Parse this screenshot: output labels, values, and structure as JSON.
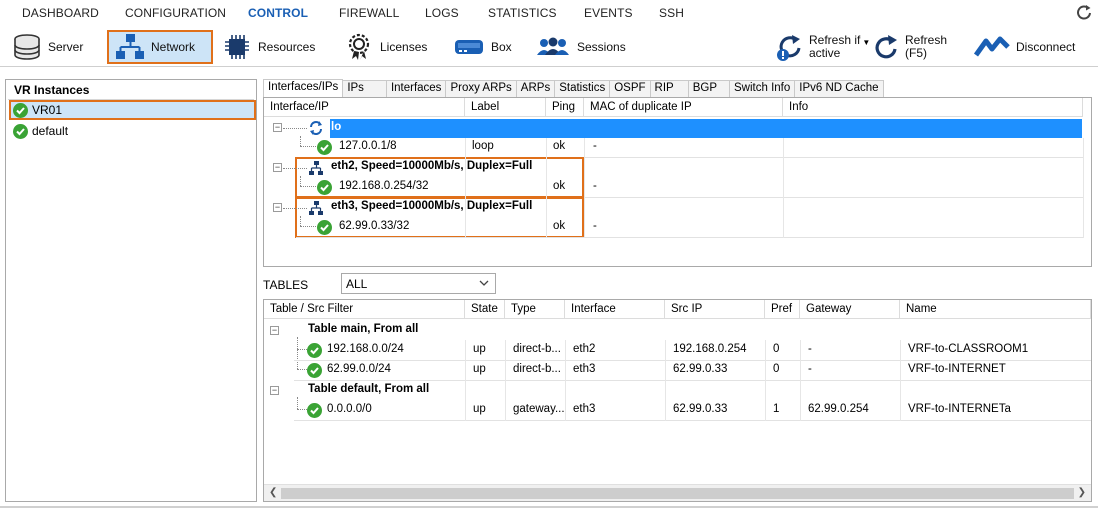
{
  "nav": {
    "items": [
      "DASHBOARD",
      "CONFIGURATION",
      "CONTROL",
      "FIREWALL",
      "LOGS",
      "STATISTICS",
      "EVENTS",
      "SSH"
    ],
    "active": "CONTROL"
  },
  "toolbar": {
    "server": "Server",
    "network": "Network",
    "resources": "Resources",
    "licenses": "Licenses",
    "box": "Box",
    "sessions": "Sessions",
    "refresh_if_active_1": "Refresh if",
    "refresh_if_active_2": "active",
    "refresh_1": "Refresh",
    "refresh_2": "(F5)",
    "disconnect": "Disconnect"
  },
  "left": {
    "title": "VR Instances",
    "items": [
      "VR01",
      "default"
    ]
  },
  "tabs": [
    "Interfaces/IPs",
    "IPs",
    "Interfaces",
    "Proxy ARPs",
    "ARPs",
    "Statistics",
    "OSPF",
    "RIP",
    "BGP",
    "Switch Info",
    "IPv6 ND Cache"
  ],
  "iface": {
    "columns": [
      "Interface/IP",
      "Label",
      "Ping",
      "MAC of duplicate IP",
      "Info"
    ],
    "groups": [
      {
        "name": "lo",
        "ip": "127.0.0.1/8",
        "label": "loop",
        "ping": "ok",
        "mac": "-"
      },
      {
        "name": "eth2, Speed=10000Mb/s, Duplex=Full",
        "ip": "192.168.0.254/32",
        "label": "",
        "ping": "ok",
        "mac": "-"
      },
      {
        "name": "eth3, Speed=10000Mb/s, Duplex=Full",
        "ip": "62.99.0.33/32",
        "label": "",
        "ping": "ok",
        "mac": "-"
      }
    ]
  },
  "tables": {
    "label": "TABLES",
    "selected": "ALL",
    "columns": [
      "Table / Src Filter",
      "State",
      "Type",
      "Interface",
      "Src IP",
      "Pref",
      "Gateway",
      "Name"
    ],
    "groups": [
      {
        "title": "Table main, From all",
        "rows": [
          [
            "192.168.0.0/24",
            "up",
            "direct-b...",
            "eth2",
            "192.168.0.254",
            "0",
            "-",
            "VRF-to-CLASSROOM1"
          ],
          [
            "62.99.0.0/24",
            "up",
            "direct-b...",
            "eth3",
            "62.99.0.33",
            "0",
            "-",
            "VRF-to-INTERNET"
          ]
        ]
      },
      {
        "title": "Table default, From all",
        "rows": [
          [
            "0.0.0.0/0",
            "up",
            "gateway...",
            "eth3",
            "62.99.0.33",
            "1",
            "62.99.0.254",
            "VRF-to-INTERNETa"
          ]
        ]
      }
    ]
  },
  "colors": {
    "accent": "#1a5fb4",
    "highlight": "#e0701a",
    "selection": "#1e90ff",
    "ok": "#3aa335"
  }
}
